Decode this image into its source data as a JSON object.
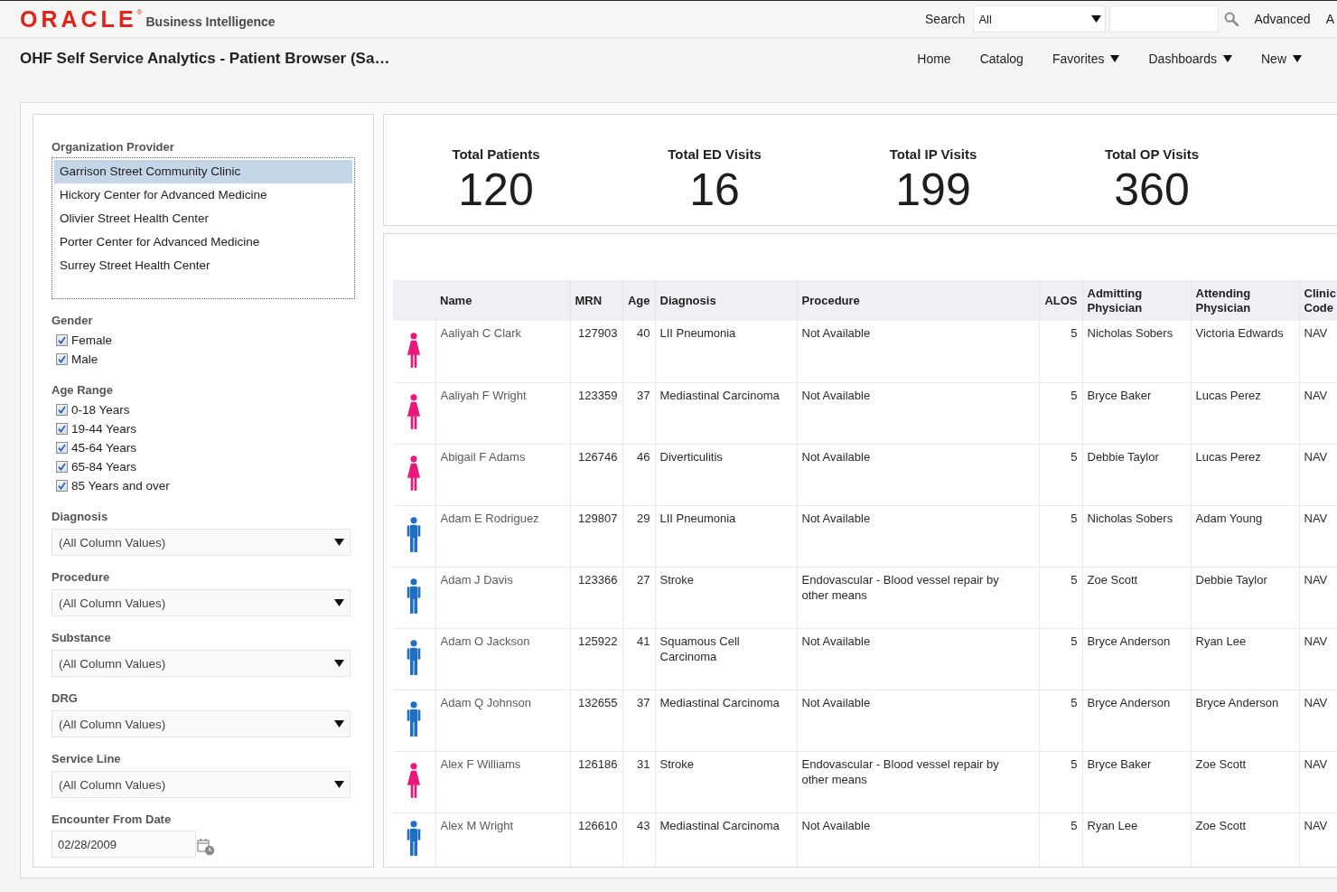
{
  "header": {
    "logo": {
      "wordmark": "ORACLE",
      "mark": "®",
      "product": "Business Intelligence"
    },
    "search": {
      "label": "Search",
      "scope": "All"
    },
    "links": [
      "Advanced",
      "A"
    ]
  },
  "page_title": "OHF Self Service Analytics - Patient Browser (Sa…",
  "nav": [
    {
      "label": "Home",
      "kind": "link"
    },
    {
      "label": "Catalog",
      "kind": "link"
    },
    {
      "label": "Favorites",
      "kind": "menu"
    },
    {
      "label": "Dashboards",
      "kind": "menu"
    },
    {
      "label": "New",
      "kind": "menu"
    }
  ],
  "filters": [
    {
      "kind": "listbox",
      "label": "Organization Provider",
      "items": [
        {
          "label": "Garrison Street Community Clinic",
          "selected": true
        },
        {
          "label": "Hickory Center for Advanced Medicine",
          "selected": false
        },
        {
          "label": "Olivier Street Health Center",
          "selected": false
        },
        {
          "label": "Porter Center for Advanced Medicine",
          "selected": false
        },
        {
          "label": "Surrey Street Health Center",
          "selected": false
        }
      ]
    },
    {
      "kind": "checkboxes",
      "label": "Gender",
      "options": [
        {
          "label": "Female",
          "checked": true
        },
        {
          "label": "Male",
          "checked": true
        }
      ]
    },
    {
      "kind": "checkboxes",
      "label": "Age Range",
      "options": [
        {
          "label": "0-18 Years",
          "checked": true
        },
        {
          "label": "19-44 Years",
          "checked": true
        },
        {
          "label": "45-64 Years",
          "checked": true
        },
        {
          "label": "65-84 Years",
          "checked": true
        },
        {
          "label": "85 Years and over",
          "checked": true
        }
      ]
    },
    {
      "kind": "dropdown",
      "label": "Diagnosis",
      "value": "(All Column Values)"
    },
    {
      "kind": "dropdown",
      "label": "Procedure",
      "value": "(All Column Values)"
    },
    {
      "kind": "dropdown",
      "label": "Substance",
      "value": "(All Column Values)"
    },
    {
      "kind": "dropdown",
      "label": "DRG",
      "value": "(All Column Values)"
    },
    {
      "kind": "dropdown",
      "label": "Service Line",
      "value": "(All Column Values)"
    },
    {
      "kind": "date",
      "label": "Encounter From Date",
      "value": "02/28/2009"
    }
  ],
  "kpis": [
    {
      "label": "Total Patients",
      "value": "120"
    },
    {
      "label": "Total ED Visits",
      "value": "16"
    },
    {
      "label": "Total IP Visits",
      "value": "199"
    },
    {
      "label": "Total OP Visits",
      "value": "360"
    }
  ],
  "table": {
    "columns": [
      "Name",
      "MRN",
      "Age",
      "Diagnosis",
      "Procedure",
      "ALOS",
      "Admitting Physician",
      "Attending Physician",
      "Clinic Code"
    ],
    "rows": [
      {
        "kind": "female",
        "cells": [
          "Aaliyah C Clark",
          "127903",
          "40",
          "LII Pneumonia",
          "Not Available",
          "5",
          "Nicholas Sobers",
          "Victoria Edwards",
          "NAV"
        ]
      },
      {
        "kind": "female",
        "cells": [
          "Aaliyah F Wright",
          "123359",
          "37",
          "Mediastinal Carcinoma",
          "Not Available",
          "5",
          "Bryce Baker",
          "Lucas Perez",
          "NAV"
        ]
      },
      {
        "kind": "female",
        "cells": [
          "Abigail F Adams",
          "126746",
          "46",
          "Diverticulitis",
          "Not Available",
          "5",
          "Debbie Taylor",
          "Lucas Perez",
          "NAV"
        ]
      },
      {
        "kind": "male",
        "cells": [
          "Adam E Rodriguez",
          "129807",
          "29",
          "LII Pneumonia",
          "Not Available",
          "5",
          "Nicholas Sobers",
          "Adam Young",
          "NAV"
        ]
      },
      {
        "kind": "male",
        "cells": [
          "Adam J Davis",
          "123366",
          "27",
          "Stroke",
          "Endovascular - Blood vessel repair by other means",
          "5",
          "Zoe Scott",
          "Debbie Taylor",
          "NAV"
        ]
      },
      {
        "kind": "male",
        "cells": [
          "Adam O Jackson",
          "125922",
          "41",
          "Squamous Cell Carcinoma",
          "Not Available",
          "5",
          "Bryce Anderson",
          "Ryan Lee",
          "NAV"
        ]
      },
      {
        "kind": "male",
        "cells": [
          "Adam Q Johnson",
          "132655",
          "37",
          "Mediastinal Carcinoma",
          "Not Available",
          "5",
          "Bryce Anderson",
          "Bryce Anderson",
          "NAV"
        ]
      },
      {
        "kind": "female",
        "cells": [
          "Alex F Williams",
          "126186",
          "31",
          "Stroke",
          "Endovascular - Blood vessel repair by other means",
          "5",
          "Bryce Baker",
          "Zoe Scott",
          "NAV"
        ]
      },
      {
        "kind": "male",
        "cells": [
          "Alex M Wright",
          "126610",
          "43",
          "Mediastinal Carcinoma",
          "Not Available",
          "5",
          "Ryan Lee",
          "Zoe Scott",
          "NAV"
        ]
      }
    ]
  }
}
